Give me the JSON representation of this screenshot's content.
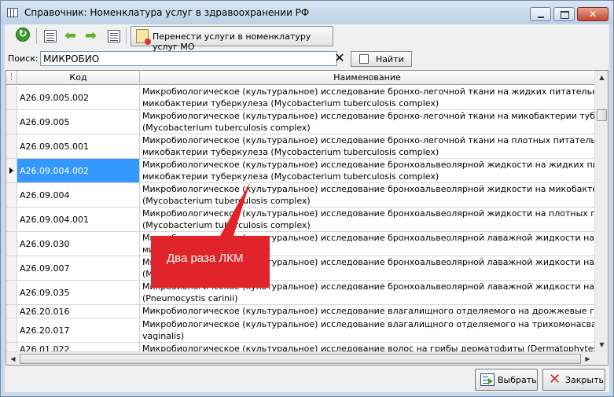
{
  "window": {
    "title": "Справочник: Номенклатура услуг в здравоохранении РФ",
    "close_glyph": "✕"
  },
  "toolbar": {
    "refresh_icon": "refresh-icon",
    "prev_arrow": "⬅",
    "next_arrow": "➡",
    "transfer_label": "Перенести услуги в номенклатуру услуг МО"
  },
  "search": {
    "label": "Поиск:",
    "value": "МИКРОБИО",
    "clear_glyph": "✕",
    "find_label": "Найти"
  },
  "grid": {
    "corner_glyph": "⋮",
    "columns": [
      "Код",
      "Наименование"
    ],
    "rows": [
      {
        "code": "A26.09.005.002",
        "name": "Микробиологическое (культуральное) исследование бронхо-легочной ткани на жидких питательных средах на\nмикобактерии туберкулеза (Mycobacterium tuberculosis complex)"
      },
      {
        "code": "A26.09.005",
        "name": "Микробиологическое (культуральное) исследование бронхо-легочной ткани на микобактерии туберкулеза\n(Mycobacterium tuberculosis complex)"
      },
      {
        "code": "A26.09.005.001",
        "name": "Микробиологическое (культуральное) исследование бронхо-легочной ткани на плотных питательных средах на\nмикобактерии туберкулеза (Mycobacterium tuberculosis complex)"
      },
      {
        "code": "A26.09.004.002",
        "name": "Микробиологическое (культуральное) исследование бронхоальвеолярной жидкости на жидких питательных ср\nмикобактерии туберкулеза (Mycobacterium tuberculosis complex)"
      },
      {
        "code": "A26.09.004",
        "name": "Микробиологическое (культуральное) исследование бронхоальвеолярной жидкости на микобактерии туберкул\n(Mycobacterium tuberculosis complex)"
      },
      {
        "code": "A26.09.004.001",
        "name": "Микробиологическое (культуральное) исследование бронхоальвеолярной жидкости на плотных питательных с\n(Mycobacterium tuberculosis complex)"
      },
      {
        "code": "A26.09.030",
        "name": "Микробиологическое (культуральное) исследование бронхоальвеолярной лаважной жидкости на грибы (дрожж\nмицелиальные)"
      },
      {
        "code": "A26.09.007",
        "name": "Микробиологическое (культуральное) исследование бронхоальвеолярной лаважной жидкости на микоплазму\n(Mycoplasma pneumoniae)"
      },
      {
        "code": "A26.09.035",
        "name": "Микробиологическое (культуральное) исследование бронхоальвеолярной лаважной жидкости на цисты пневмо\n(Pneumocystis carinii)"
      },
      {
        "code": "A26.20.016",
        "name": "Микробиологическое (культуральное) исследование влагалищного отделяемого на дрожжевые грибы"
      },
      {
        "code": "A26.20.017",
        "name": "Микробиологическое (культуральное) исследование влагалищного отделяемого на трихомонасвагиналис (Trich\nvaginalis)"
      },
      {
        "code": "A26.01.022",
        "name": "Микробиологическое (культуральное) исследование волос на грибы дерматофиты (Dermatophytes)"
      }
    ],
    "selected_row": 3
  },
  "scroll": {
    "up": "▲",
    "down": "▼",
    "left": "◀",
    "right": "▶"
  },
  "footer": {
    "select_label": "Выбрать",
    "close_label": "Закрыть",
    "close_glyph": "✕"
  },
  "annotation": {
    "label": "Два раза ЛКМ",
    "color": "#e0242a"
  }
}
